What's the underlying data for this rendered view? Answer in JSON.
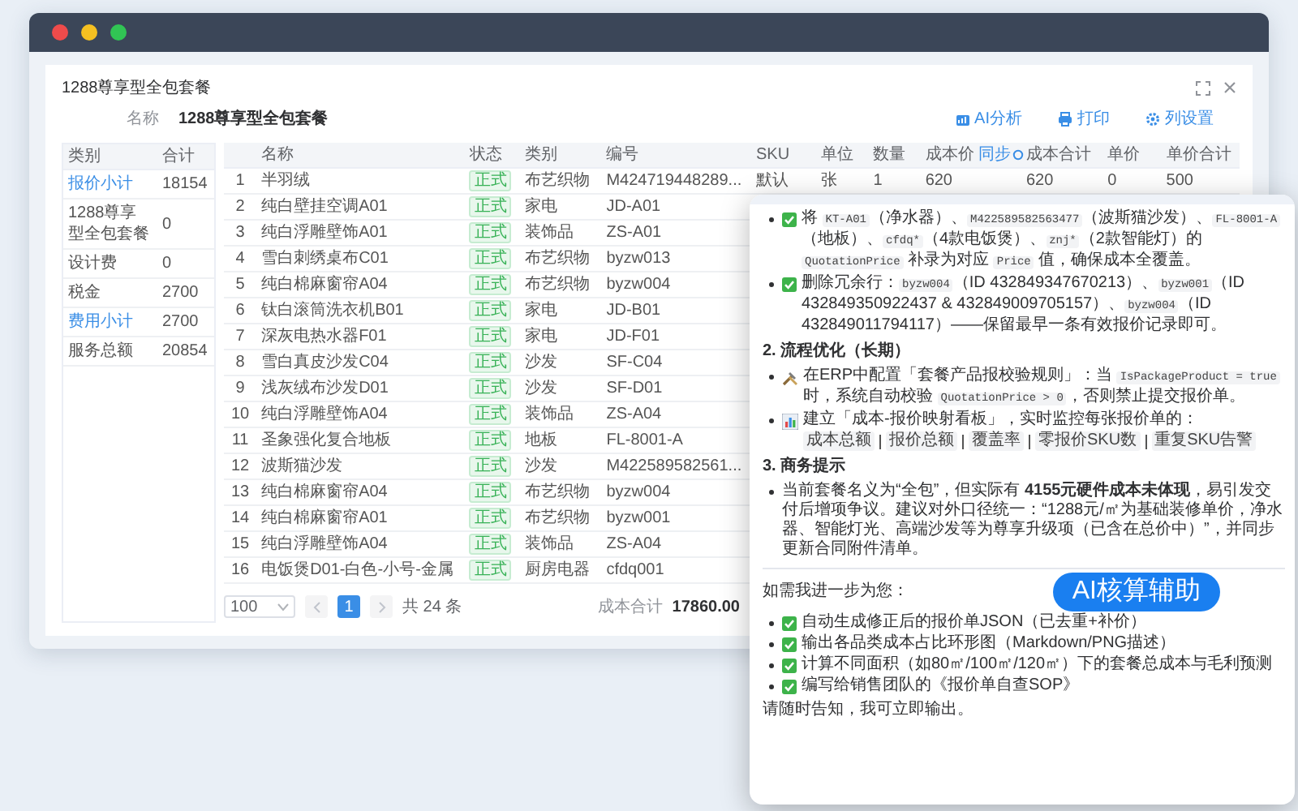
{
  "dialog": {
    "title": "1288尊享型全包套餐",
    "name_label": "名称",
    "name_value": "1288尊享型全包套餐",
    "actions": [
      "AI分析",
      "打印",
      "列设置"
    ]
  },
  "summary_table": {
    "columns": [
      "类别",
      "合计"
    ],
    "rows": [
      {
        "label": "报价小计",
        "total": "18154",
        "kind": "link"
      },
      {
        "label": "1288尊享型全包套餐",
        "total": "0",
        "kind": "plain"
      },
      {
        "label": "设计费",
        "total": "0",
        "kind": "plain"
      },
      {
        "label": "税金",
        "total": "2700",
        "kind": "plain"
      },
      {
        "label": "费用小计",
        "total": "2700",
        "kind": "link"
      },
      {
        "label": "服务总额",
        "total": "20854",
        "kind": "plain"
      }
    ]
  },
  "items_table": {
    "columns": [
      {
        "label": "名称"
      },
      {
        "label": "状态"
      },
      {
        "label": "类别"
      },
      {
        "label": "编号"
      },
      {
        "label": "SKU"
      },
      {
        "label": "单位"
      },
      {
        "label": "数量"
      },
      {
        "label": "成本价",
        "link": "同步"
      },
      {
        "label": "成本合计"
      },
      {
        "label": "单价"
      },
      {
        "label": "单价合计"
      }
    ],
    "rows": [
      {
        "index": "1",
        "name": "半羽绒",
        "status": "正式",
        "category": "布艺织物",
        "code": "M424719448289...",
        "sku": "默认",
        "unit": "张",
        "qty": "1",
        "cost": "620",
        "cost_total": "620",
        "price": "0",
        "price_total": "500"
      },
      {
        "index": "2",
        "name": "纯白壁挂空调A01",
        "status": "正式",
        "category": "家电",
        "code": "JD-A01"
      },
      {
        "index": "3",
        "name": "纯白浮雕壁饰A01",
        "status": "正式",
        "category": "装饰品",
        "code": "ZS-A01"
      },
      {
        "index": "4",
        "name": "雪白刺绣桌布C01",
        "status": "正式",
        "category": "布艺织物",
        "code": "byzw013"
      },
      {
        "index": "5",
        "name": "纯白棉麻窗帘A04",
        "status": "正式",
        "category": "布艺织物",
        "code": "byzw004"
      },
      {
        "index": "6",
        "name": "钛白滚筒洗衣机B01",
        "status": "正式",
        "category": "家电",
        "code": "JD-B01"
      },
      {
        "index": "7",
        "name": "深灰电热水器F01",
        "status": "正式",
        "category": "家电",
        "code": "JD-F01"
      },
      {
        "index": "8",
        "name": "雪白真皮沙发C04",
        "status": "正式",
        "category": "沙发",
        "code": "SF-C04"
      },
      {
        "index": "9",
        "name": "浅灰绒布沙发D01",
        "status": "正式",
        "category": "沙发",
        "code": "SF-D01"
      },
      {
        "index": "10",
        "name": "纯白浮雕壁饰A04",
        "status": "正式",
        "category": "装饰品",
        "code": "ZS-A04"
      },
      {
        "index": "11",
        "name": "圣象强化复合地板",
        "status": "正式",
        "category": "地板",
        "code": "FL-8001-A"
      },
      {
        "index": "12",
        "name": "波斯猫沙发",
        "status": "正式",
        "category": "沙发",
        "code": "M422589582561..."
      },
      {
        "index": "13",
        "name": "纯白棉麻窗帘A04",
        "status": "正式",
        "category": "布艺织物",
        "code": "byzw004"
      },
      {
        "index": "14",
        "name": "纯白棉麻窗帘A01",
        "status": "正式",
        "category": "布艺织物",
        "code": "byzw001"
      },
      {
        "index": "15",
        "name": "纯白浮雕壁饰A04",
        "status": "正式",
        "category": "装饰品",
        "code": "ZS-A04"
      },
      {
        "index": "16",
        "name": "电饭煲D01-白色-小号-金属",
        "status": "正式",
        "category": "厨房电器",
        "code": "cfdq001"
      }
    ]
  },
  "pagination": {
    "page_size": "100",
    "pages": [
      {
        "label": "1",
        "selected": true
      }
    ],
    "total": "共 24 条",
    "cost_total_label": "成本合计",
    "cost_total": "17860.00"
  },
  "assistant_panel": {
    "items": [
      {
        "kind": "check",
        "parts": [
          {
            "text": "将 "
          },
          {
            "text": "KT-A01",
            "code": true
          },
          {
            "text": "（净水器）、"
          },
          {
            "text": "M422589582563477",
            "code": true
          },
          {
            "text": "（波斯猫沙发）、"
          },
          {
            "text": "FL-8001-A",
            "code": true
          },
          {
            "text": "（地板）、"
          },
          {
            "text": "cfdq*",
            "code": true
          },
          {
            "text": "（4款电饭煲）、"
          },
          {
            "text": "znj*",
            "code": true
          },
          {
            "text": "（2款智能灯）的 "
          },
          {
            "text": "QuotationPrice",
            "code": true
          },
          {
            "text": " 补录为对应 "
          },
          {
            "text": "Price",
            "code": true
          },
          {
            "text": " 值，确保成本全覆盖。"
          }
        ]
      },
      {
        "kind": "check",
        "parts": [
          {
            "text": "删除冗余行："
          },
          {
            "text": "byzw004",
            "code": true
          },
          {
            "text": "（ID 432849347670213）、"
          },
          {
            "text": "byzw001",
            "code": true
          },
          {
            "text": "（ID 432849350922437 & 432849009705157）、"
          },
          {
            "text": "byzw004",
            "code": true
          },
          {
            "text": "（ID 432849011794117）——保留最早一条有效报价记录即可。"
          }
        ]
      },
      {
        "kind": "heading",
        "parts": [
          {
            "text": "2. 流程优化（长期）"
          }
        ]
      },
      {
        "kind": "tool",
        "parts": [
          {
            "text": "在ERP中配置「套餐产品报校验规则」：当 "
          },
          {
            "text": "IsPackageProduct = true",
            "code": true
          },
          {
            "text": " 时，系统自动校验 "
          },
          {
            "text": "QuotationPrice > 0",
            "code": true
          },
          {
            "text": "，否则禁止提交报价单。"
          }
        ]
      },
      {
        "kind": "chart",
        "parts": [
          {
            "text": "建立「成本-报价映射看板」，实时监控每张报价单的："
          }
        ],
        "chips": [
          "成本总额",
          "报价总额",
          "覆盖率",
          "零报价SKU数",
          "重复SKU告警"
        ]
      },
      {
        "kind": "heading",
        "parts": [
          {
            "text": "3. 商务提示"
          }
        ]
      },
      {
        "kind": "bullet",
        "parts": [
          {
            "text": "当前套餐名义为“全包”，但实际有 **4155元硬件成本未体现**，易引发交付后增项争议。建议对外口径统一：“1288元/㎡为基础装修单价，净水器、智能灯光、高端沙发等为尊享升级项（已含在总价中）”，并同步更新合同附件清单。"
          }
        ]
      }
    ],
    "prompt": "如需我进一步为您：",
    "badge": "AI核算辅助",
    "offers": [
      "自动生成修正后的报价单JSON（已去重+补价）",
      "输出各品类成本占比环形图（Markdown/PNG描述）",
      "计算不同面积（如80㎡/100㎡/120㎡）下的套餐总成本与毛利预测",
      "编写给销售团队的《报价单自查SOP》"
    ],
    "closing": "请随时告知，我可立即输出。"
  }
}
